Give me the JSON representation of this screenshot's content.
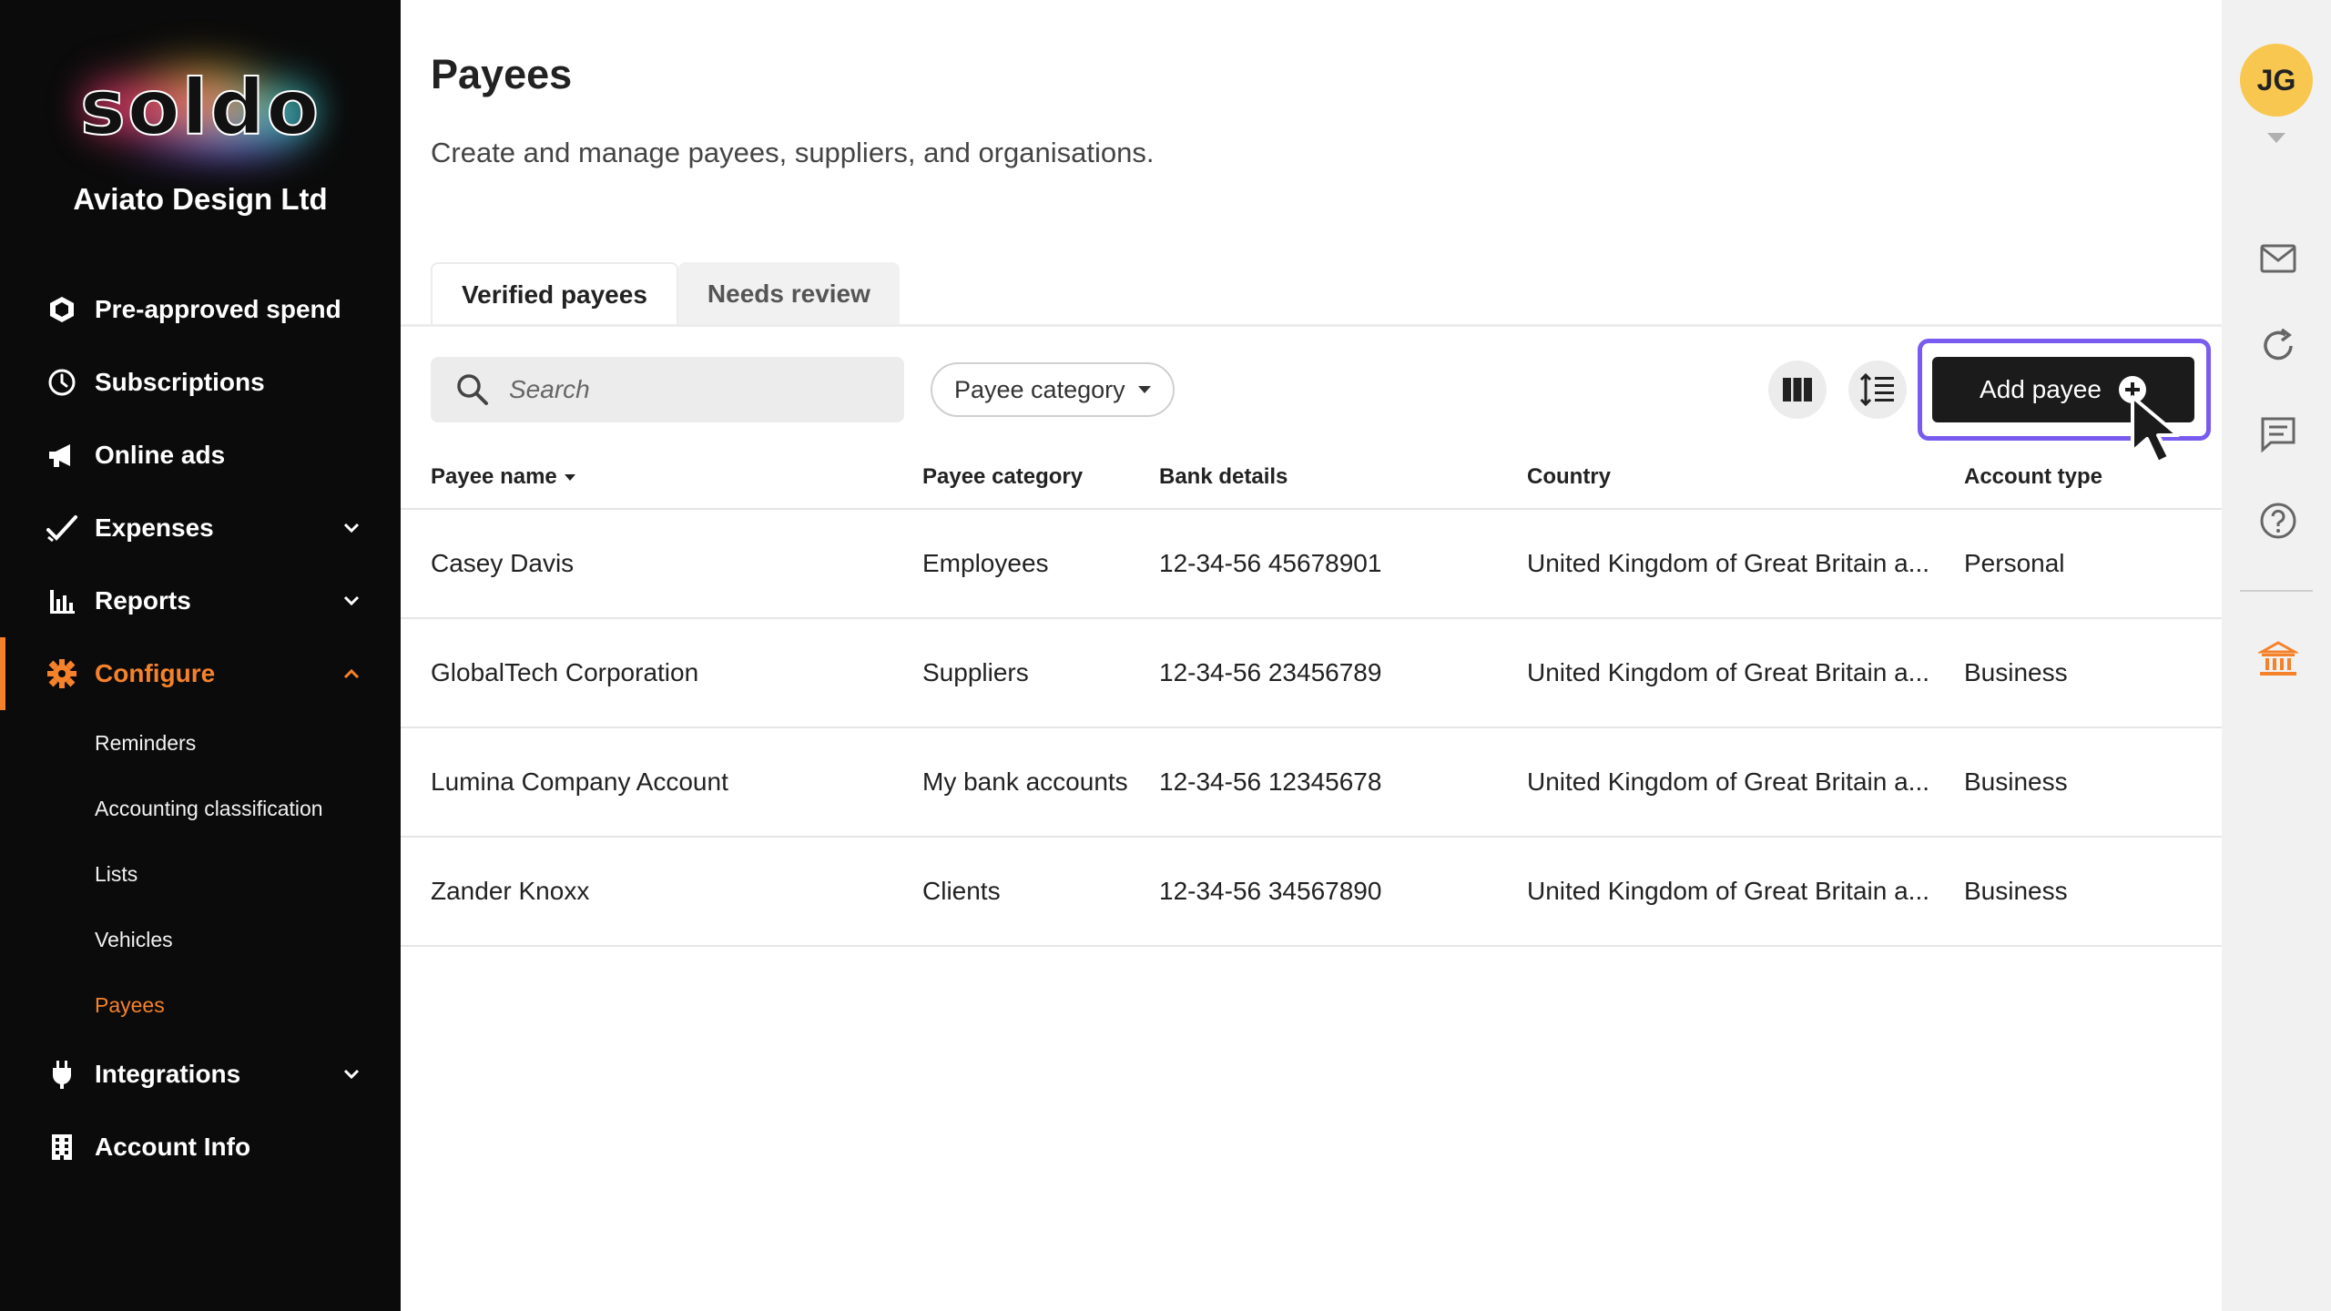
{
  "sidebar": {
    "logo_text": "soldo",
    "company": "Aviato Design Ltd",
    "items": [
      {
        "label": "Pre-approved spend",
        "icon": "hexagon-icon"
      },
      {
        "label": "Subscriptions",
        "icon": "clock-icon"
      },
      {
        "label": "Online ads",
        "icon": "megaphone-icon"
      },
      {
        "label": "Expenses",
        "icon": "check-icon",
        "expandable": true
      },
      {
        "label": "Reports",
        "icon": "bar-chart-icon",
        "expandable": true
      },
      {
        "label": "Configure",
        "icon": "gear-icon",
        "expandable": true,
        "expanded": true,
        "active": true
      },
      {
        "label": "Integrations",
        "icon": "plug-icon",
        "expandable": true
      },
      {
        "label": "Account Info",
        "icon": "building-icon"
      }
    ],
    "configure_subitems": [
      "Reminders",
      "Accounting classification",
      "Lists",
      "Vehicles",
      "Payees"
    ],
    "active_subitem": "Payees"
  },
  "main": {
    "title": "Payees",
    "subtitle": "Create and manage payees, suppliers, and organisations.",
    "tabs": [
      {
        "label": "Verified payees",
        "active": true
      },
      {
        "label": "Needs review",
        "active": false
      }
    ],
    "search_placeholder": "Search",
    "filter_label": "Payee category",
    "add_button_label": "Add payee",
    "columns": [
      "Payee name",
      "Payee category",
      "Bank details",
      "Country",
      "Account type"
    ],
    "rows": [
      [
        "Casey Davis",
        "Employees",
        "12-34-56 45678901",
        "United Kingdom of Great Britain a...",
        "Personal"
      ],
      [
        "GlobalTech Corporation",
        "Suppliers",
        "12-34-56 23456789",
        "United Kingdom of Great Britain a...",
        "Business"
      ],
      [
        "Lumina Company Account",
        "My bank accounts",
        "12-34-56 12345678",
        "United Kingdom of Great Britain a...",
        "Business"
      ],
      [
        "Zander Knoxx",
        "Clients",
        "12-34-56 34567890",
        "United Kingdom of Great Britain a...",
        "Business"
      ]
    ]
  },
  "rail": {
    "avatar_initials": "JG",
    "icons": [
      "mail-icon",
      "refresh-icon",
      "chat-icon",
      "help-icon",
      "bank-icon"
    ]
  },
  "colors": {
    "accent": "#f5822a",
    "highlight": "#7a5bf0",
    "avatar": "#f8c750",
    "sidebar_bg": "#0b0b0b"
  }
}
